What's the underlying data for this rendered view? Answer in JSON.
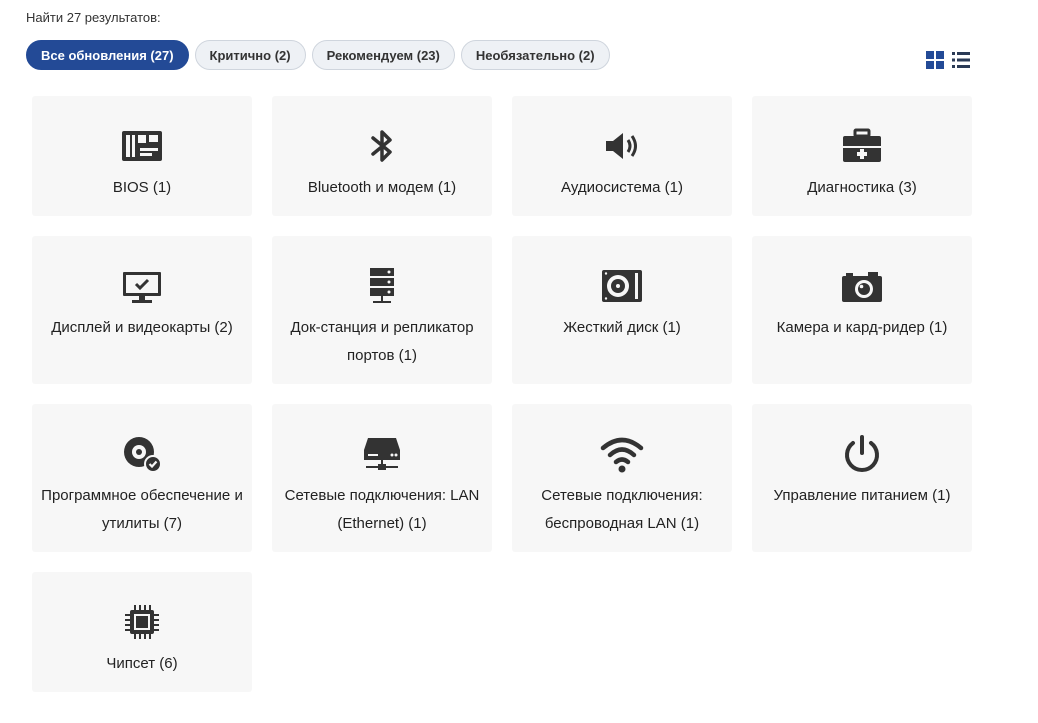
{
  "results_text": "Найти 27 результатов:",
  "filters": [
    {
      "label": "Все обновления (27)",
      "active": true
    },
    {
      "label": "Критично (2)",
      "active": false
    },
    {
      "label": "Рекомендуем (23)",
      "active": false
    },
    {
      "label": "Необязательно (2)",
      "active": false
    }
  ],
  "view_toggle": {
    "grid_icon": "grid-icon",
    "list_icon": "list-icon",
    "active": "grid"
  },
  "categories": [
    {
      "label": "BIOS (1)",
      "icon": "motherboard-icon"
    },
    {
      "label": "Bluetooth и модем (1)",
      "icon": "bluetooth-icon"
    },
    {
      "label": "Аудиосистема (1)",
      "icon": "speaker-icon"
    },
    {
      "label": "Диагностика (3)",
      "icon": "toolbox-icon"
    },
    {
      "label": "Дисплей и видеокарты (2)",
      "icon": "monitor-icon"
    },
    {
      "label": "Док-станция и репликатор портов (1)",
      "icon": "server-stack-icon"
    },
    {
      "label": "Жесткий диск (1)",
      "icon": "hard-drive-icon"
    },
    {
      "label": "Камера и кард-ридер (1)",
      "icon": "camera-icon"
    },
    {
      "label": "Программное обеспечение и утилиты (7)",
      "icon": "disc-check-icon"
    },
    {
      "label": "Сетевые подключения: LAN (Ethernet) (1)",
      "icon": "network-drive-icon"
    },
    {
      "label": "Сетевые подключения: беспроводная LAN (1)",
      "icon": "wifi-icon"
    },
    {
      "label": "Управление питанием (1)",
      "icon": "power-icon"
    },
    {
      "label": "Чипсет (6)",
      "icon": "chip-icon"
    }
  ],
  "colors": {
    "accent": "#234a96",
    "card_bg": "#f7f7f7",
    "icon": "#333333"
  }
}
